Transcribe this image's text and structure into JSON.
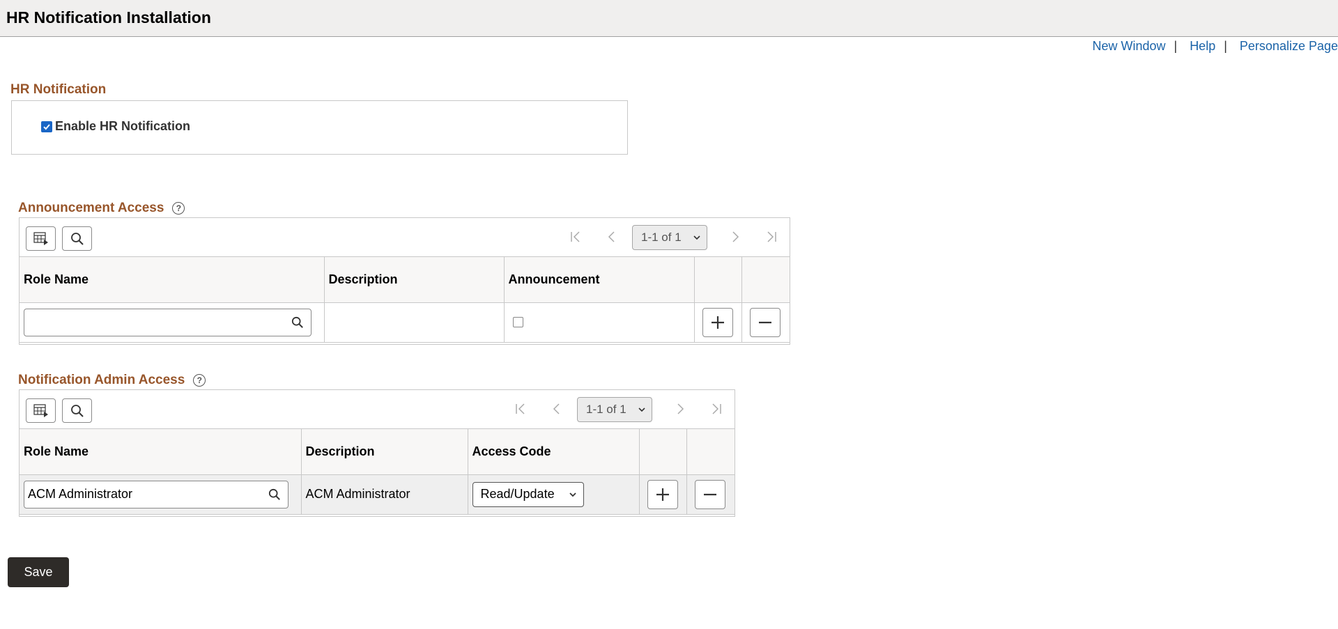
{
  "page": {
    "title": "HR Notification Installation"
  },
  "toplinks": {
    "new_window": "New Window",
    "help": "Help",
    "personalize": "Personalize Page",
    "separator": "|"
  },
  "hr_notification": {
    "title": "HR Notification",
    "enable_label": "Enable HR Notification",
    "enabled": true
  },
  "announcement_access": {
    "title": "Announcement Access",
    "pager": "1-1 of 1",
    "columns": [
      "Role Name",
      "Description",
      "Announcement"
    ],
    "rows": [
      {
        "role_name": "",
        "description": "",
        "announcement": false
      }
    ]
  },
  "notification_admin_access": {
    "title": "Notification Admin Access",
    "pager": "1-1 of 1",
    "columns": [
      "Role Name",
      "Description",
      "Access Code"
    ],
    "rows": [
      {
        "role_name": "ACM Administrator",
        "description": "ACM Administrator",
        "access_code": "Read/Update"
      }
    ]
  },
  "actions": {
    "save": "Save"
  },
  "colors": {
    "section_title": "#98562b",
    "link": "#1b63a8",
    "checkbox": "#1a66c6",
    "save_bg": "#2e2b28"
  }
}
